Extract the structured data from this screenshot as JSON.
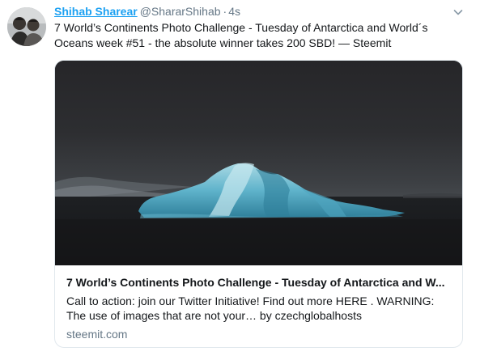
{
  "tweet": {
    "author_name": "Shihab Sharear",
    "author_handle": "@ShararShihab",
    "separator": "·",
    "timestamp": "4s",
    "text": "7 World’s Continents Photo Challenge - Tuesday of Antarctica and World´s Oceans week #51 - the absolute winner takes 200 SBD! — Steemit"
  },
  "card": {
    "title": "7 World’s Continents Photo Challenge - Tuesday of Antarctica and W...",
    "description": "Call to action: join our Twitter Initiative! Find out more HERE . WARNING: The use of images that are not your… by czechglobalhosts",
    "domain": "steemit.com"
  },
  "icons": {
    "caret": "chevron-down-icon"
  },
  "colors": {
    "accent": "#1da1f2",
    "secondary_text": "#657786",
    "border": "#e1e8ed"
  }
}
